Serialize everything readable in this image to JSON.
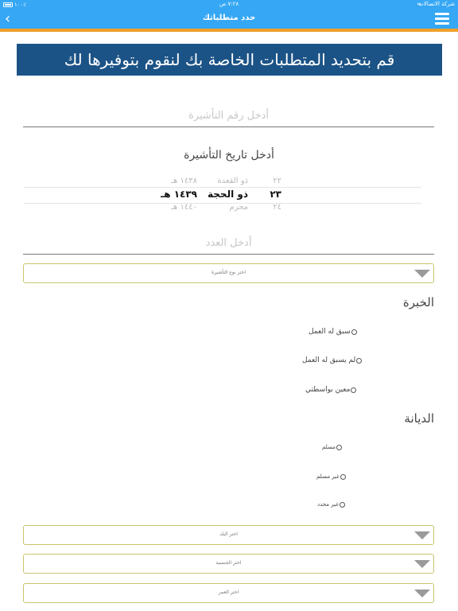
{
  "status_bar": {
    "carrier": "شركة الاتصالات",
    "time": "٧:٢٨ ص",
    "battery": "١٠٠٪"
  },
  "nav": {
    "title": "حدد متطلباتك",
    "back_glyph": "‹"
  },
  "banner": {
    "text": "قم بتحديد المتطلبات الخاصة بك لنقوم بتوفيرها لك"
  },
  "visa_number": {
    "placeholder": "أدخل رقم التأشيرة",
    "value": ""
  },
  "visa_date": {
    "label": "أدخل تاريخ التأشيرة",
    "rows": [
      {
        "day": "٢٢",
        "month": "ذو القعدة",
        "year": "١٤٣٨ هـ"
      },
      {
        "day": "٢٣",
        "month": "ذو الحجة",
        "year": "١٤٣٩ هـ"
      },
      {
        "day": "٢٤",
        "month": "محرم",
        "year": "١٤٤٠ هـ"
      }
    ]
  },
  "count": {
    "placeholder": "أدخل العدد",
    "value": ""
  },
  "visa_type_dropdown": {
    "label": "اختر نوع التأشيرة"
  },
  "experience": {
    "heading": "الخبرة",
    "options": [
      "سبق له العمل",
      "لم يسبق له العمل",
      "معين بواسطتي"
    ]
  },
  "religion": {
    "heading": "الديانة",
    "options": [
      "مسلم",
      "غير مسلم",
      "غير محدد"
    ]
  },
  "country_dropdown": {
    "label": "اختر البلد"
  },
  "nationality_dropdown": {
    "label": "اختر الجنسية"
  },
  "age_dropdown": {
    "label": "اختر العمر"
  },
  "icons": {
    "back": "chevron-left-icon",
    "menu": "hamburger-menu-icon",
    "dropdown": "triangle-down-icon"
  },
  "colors": {
    "nav": "#35a7f4",
    "accent_strip": "#f0a02a",
    "banner": "#1c5386",
    "dropdown_border": "#c9c46e"
  }
}
